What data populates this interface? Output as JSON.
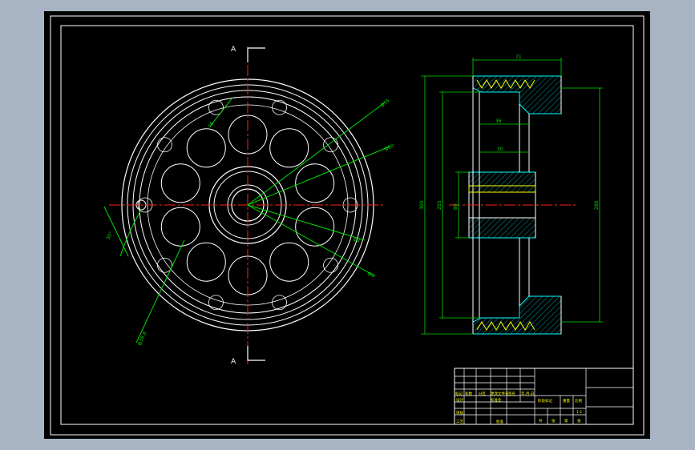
{
  "colors": {
    "background_outer": "#a8b4c4",
    "sheet": "#000000",
    "outline": "#ffffff",
    "centerline": "#ff2020",
    "dimension": "#00dd00",
    "hatch": "#00bfbf",
    "cut": "#00ffff",
    "label": "#ffff00"
  },
  "section": {
    "top_label": "A",
    "bottom_label": "A"
  },
  "front_view_leaders": [
    {
      "id": "leader-hole",
      "text": "16"
    },
    {
      "id": "leader-1",
      "text": "ф16"
    },
    {
      "id": "leader-2",
      "text": "ф60"
    },
    {
      "id": "leader-3",
      "text": "ф2"
    },
    {
      "id": "leader-4",
      "text": "ф6"
    },
    {
      "id": "leader-angle",
      "text": "30°"
    },
    {
      "id": "leader-radius",
      "text": "ф38.8"
    }
  ],
  "side_view_dims": [
    {
      "id": "dim-width",
      "text": "71"
    },
    {
      "id": "dim-inner1",
      "text": "36"
    },
    {
      "id": "dim-inner2",
      "text": "30"
    },
    {
      "id": "dim-d1",
      "text": "300"
    },
    {
      "id": "dim-d2",
      "text": "255"
    },
    {
      "id": "dim-d3",
      "text": "80"
    },
    {
      "id": "dim-d4",
      "text": "286"
    }
  ],
  "title_block": {
    "row_labels": [
      "标记",
      "处数",
      "分区",
      "更改文件号",
      "签名",
      "年.月.日"
    ],
    "designer": "设计",
    "standard": "标准化",
    "review": "审核",
    "process": "工艺",
    "approve": "批准",
    "stage": "阶段标记",
    "weight": "重量",
    "scale": "比例",
    "scale_value": "1:1",
    "sheets": [
      "共",
      "张",
      "第",
      "张"
    ]
  }
}
